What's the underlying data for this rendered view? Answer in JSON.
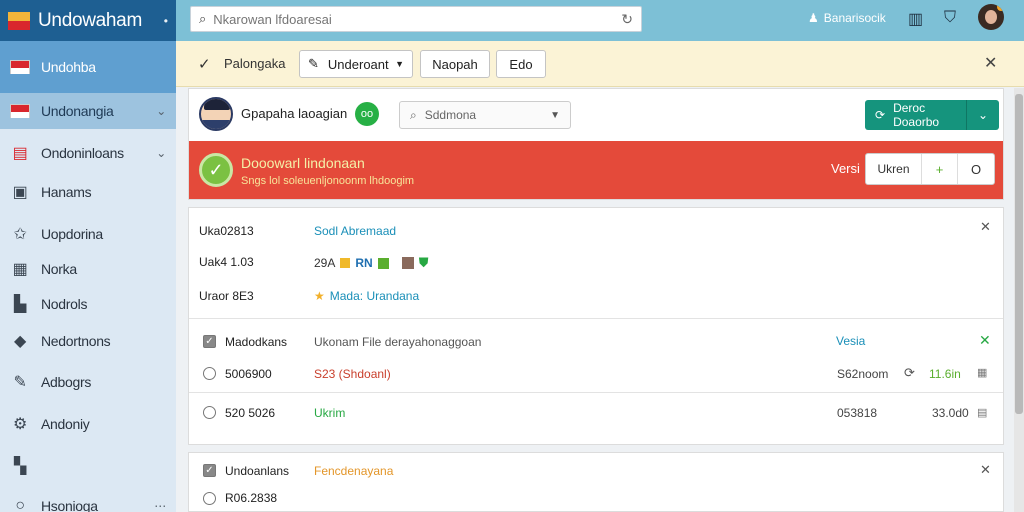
{
  "app": {
    "title": "Undowaham"
  },
  "search": {
    "placeholder": "Nkarowan lfdoaresai"
  },
  "topbar": {
    "user": "Banarisocik"
  },
  "sidebar": {
    "items": [
      {
        "label": "Undohba",
        "icon": "flag-icon"
      },
      {
        "label": "Undonangia",
        "icon": "flag-icon"
      },
      {
        "label": "Ondoninloans",
        "icon": "card-icon"
      },
      {
        "label": "Hanams",
        "icon": "box-icon"
      },
      {
        "label": "Uopdorina",
        "icon": "star-icon"
      },
      {
        "label": "Norka",
        "icon": "grid-icon"
      },
      {
        "label": "Nodrols",
        "icon": "folder-icon"
      },
      {
        "label": "Nedortnons",
        "icon": "pin-icon"
      },
      {
        "label": "Adbogrs",
        "icon": "pen-icon"
      },
      {
        "label": "Andoniy",
        "icon": "gear-icon"
      },
      {
        "label": "",
        "icon": "tiles-icon"
      },
      {
        "label": "Hsonioga",
        "icon": "circle-icon"
      }
    ]
  },
  "toolbar": {
    "label": "Palongaka",
    "edit_button": "Underoant",
    "button2": "Naopah",
    "button3": "Edo"
  },
  "profile": {
    "name": "Gpapaha laoagian",
    "badge": "oo",
    "select_value": "Sddmona",
    "action_button": "Deroc Doaorbo"
  },
  "alert": {
    "title": "Dooowarl lindonaan",
    "subtitle": "Sngs lol soleuenljonoonm lhdoogim",
    "version_label": "Versi",
    "seg_label": "Ukren",
    "seg_plus": "+",
    "seg_circle": "O",
    "colors": {
      "bg": "#e44a3a"
    }
  },
  "details": {
    "rows": [
      {
        "label": "Uka02813",
        "value": "Sodl Abremaad"
      },
      {
        "label": "Uak4 1.03",
        "value": "29A",
        "tag": "RN"
      },
      {
        "label": "Uraor 8E3",
        "value": "Mada: Urandana"
      }
    ]
  },
  "table": {
    "header": {
      "name": "Madodkans",
      "file": "Ukonam File derayahonaggoan",
      "col": "Vesia"
    },
    "rows": [
      {
        "id": "5006900",
        "value": "S23 (Shdoanl)",
        "code": "S62noom",
        "amount": "11.6in"
      },
      {
        "id": "520 5026",
        "value": "Ukrim",
        "code": "053818",
        "amount": "33.0d0"
      }
    ]
  },
  "panel3": {
    "header": {
      "name": "Undoanlans",
      "tag": "Fencdenayana"
    },
    "rows": [
      {
        "id": "R06.2838"
      }
    ]
  }
}
